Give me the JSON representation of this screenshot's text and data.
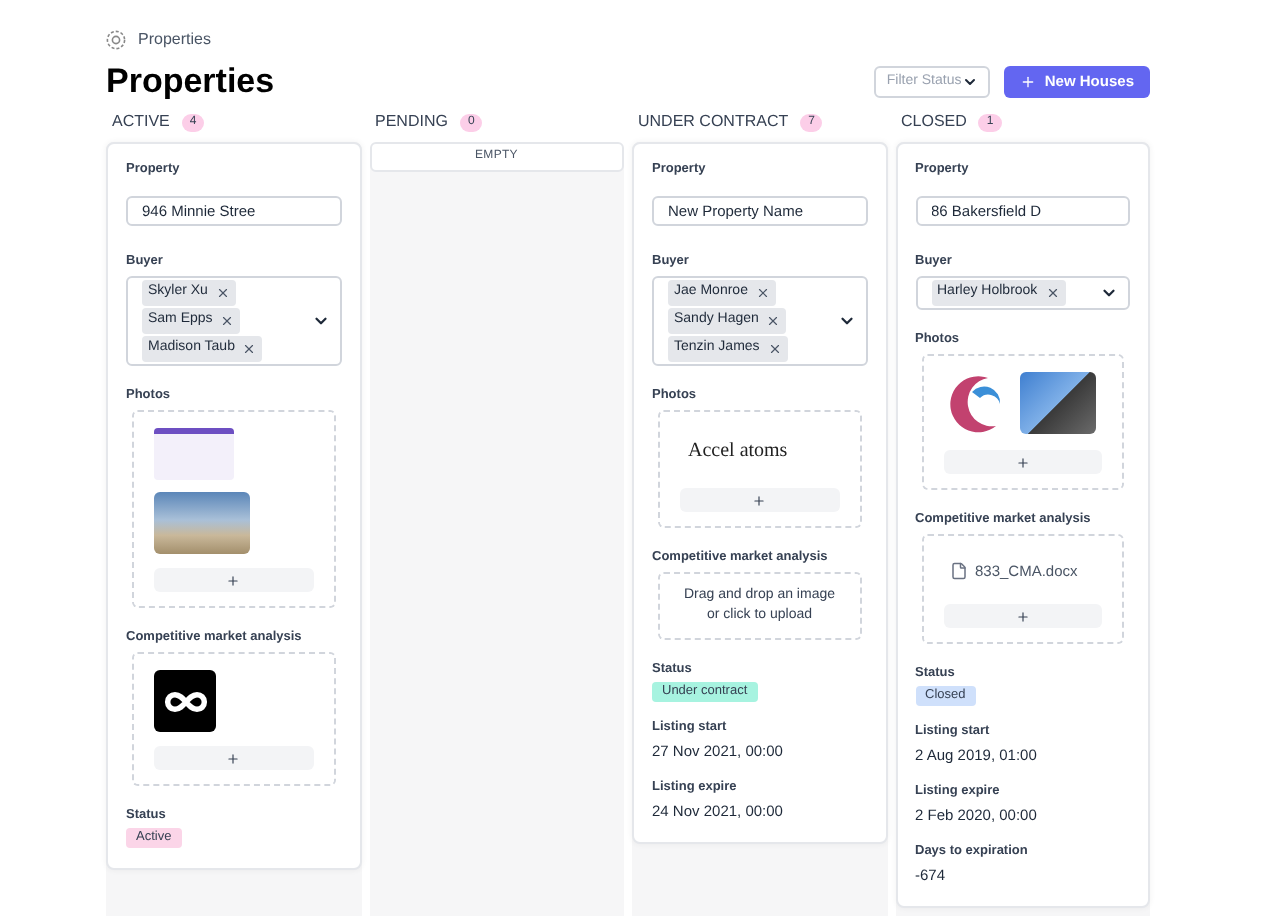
{
  "breadcrumb": "Properties",
  "title": "Properties",
  "filter": {
    "placeholder": "Filter Status"
  },
  "new_button": "New Houses",
  "columns": [
    {
      "title": "ACTIVE",
      "count": "4",
      "cards": [
        {
          "property_label": "Property",
          "buyer_label": "Buyer",
          "property": "946 Minnie Stree",
          "buyers": [
            "Skyler Xu",
            "Sam Epps",
            "Madison Taub"
          ],
          "sections": [
            {
              "label": "Photos",
              "kind": "media",
              "items": [
                {
                  "kind": "screenshot"
                },
                {
                  "kind": "house"
                }
              ]
            },
            {
              "label": "Competitive market analysis",
              "kind": "media",
              "items": [
                {
                  "kind": "infinity"
                }
              ]
            }
          ],
          "status": {
            "label": "Status",
            "value": "Active",
            "color": "#fbd5e8"
          }
        }
      ]
    },
    {
      "title": "PENDING",
      "count": "0",
      "empty": "EMPTY"
    },
    {
      "title": "UNDER CONTRACT",
      "count": "7",
      "cards": [
        {
          "property_label": "Property",
          "buyer_label": "Buyer",
          "property": "New Property Name",
          "buyers": [
            "Jae Monroe",
            "Sandy Hagen",
            "Tenzin James"
          ],
          "sections": [
            {
              "label": "Photos",
              "kind": "media",
              "items": [
                {
                  "kind": "wordmark",
                  "text": "Accel atoms"
                }
              ]
            },
            {
              "label": "Competitive market analysis",
              "kind": "upload",
              "hint": "Drag and drop an image or click to upload"
            }
          ],
          "status": {
            "label": "Status",
            "value": "Under contract",
            "color": "#a7f3e0"
          },
          "fields": [
            {
              "label": "Listing start",
              "value": "27 Nov 2021, 00:00"
            },
            {
              "label": "Listing expire",
              "value": "24 Nov 2021, 00:00"
            }
          ]
        }
      ]
    },
    {
      "title": "CLOSED",
      "count": "1",
      "cards": [
        {
          "property_label": "Property",
          "buyer_label": "Buyer",
          "property": "86 Bakersfield D",
          "buyers": [
            "Harley Holbrook"
          ],
          "sections": [
            {
              "label": "Photos",
              "kind": "media",
              "items": [
                {
                  "kind": "swirl"
                },
                {
                  "kind": "building"
                }
              ]
            },
            {
              "label": "Competitive market analysis",
              "kind": "media",
              "items": [
                {
                  "kind": "file",
                  "text": "833_CMA.docx"
                }
              ]
            }
          ],
          "status": {
            "label": "Status",
            "value": "Closed",
            "color": "#cfe0fb"
          },
          "fields": [
            {
              "label": "Listing start",
              "value": "2 Aug 2019, 01:00"
            },
            {
              "label": "Listing expire",
              "value": "2 Feb 2020, 00:00"
            },
            {
              "label": "Days to expiration",
              "value": "-674"
            }
          ]
        }
      ]
    }
  ]
}
